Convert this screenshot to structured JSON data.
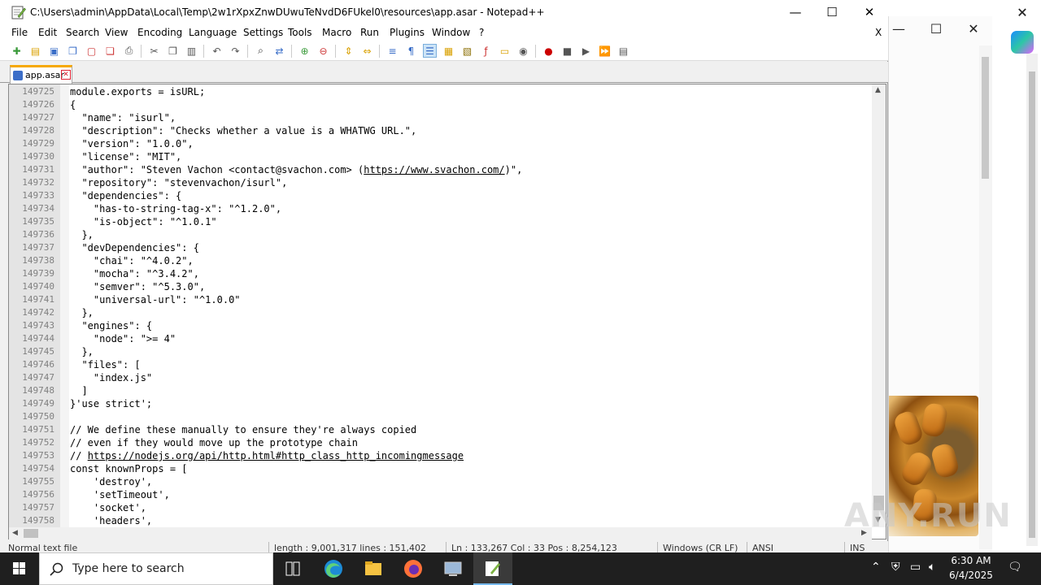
{
  "window": {
    "title": "C:\\Users\\admin\\AppData\\Local\\Temp\\2w1rXpxZnwDUwuTeNvdD6FUkel0\\resources\\app.asar - Notepad++",
    "minimize": "—",
    "maximize": "☐",
    "close": "✕"
  },
  "menu": {
    "items": [
      "File",
      "Edit",
      "Search",
      "View",
      "Encoding",
      "Language",
      "Settings",
      "Tools",
      "Macro",
      "Run",
      "Plugins",
      "Window",
      "?"
    ],
    "close_doc": "X"
  },
  "tab": {
    "label": "app.asar",
    "close": "✕"
  },
  "editor": {
    "line_numbers": [
      "149725",
      "149726",
      "149727",
      "149728",
      "149729",
      "149730",
      "149731",
      "149732",
      "149733",
      "149734",
      "149735",
      "149736",
      "149737",
      "149738",
      "149739",
      "149740",
      "149741",
      "149742",
      "149743",
      "149744",
      "149745",
      "149746",
      "149747",
      "149748",
      "149749",
      "149750",
      "149751",
      "149752",
      "149753",
      "149754",
      "149755",
      "149756",
      "149757",
      "149758"
    ],
    "lines": [
      "module.exports = isURL;",
      "{",
      "  \"name\": \"isurl\",",
      "  \"description\": \"Checks whether a value is a WHATWG URL.\",",
      "  \"version\": \"1.0.0\",",
      "  \"license\": \"MIT\",",
      "  \"author\": \"Steven Vachon <contact@svachon.com> (",
      "  \"repository\": \"stevenvachon/isurl\",",
      "  \"dependencies\": {",
      "    \"has-to-string-tag-x\": \"^1.2.0\",",
      "    \"is-object\": \"^1.0.1\"",
      "  },",
      "  \"devDependencies\": {",
      "    \"chai\": \"^4.0.2\",",
      "    \"mocha\": \"^3.4.2\",",
      "    \"semver\": \"^5.3.0\",",
      "    \"universal-url\": \"^1.0.0\"",
      "  },",
      "  \"engines\": {",
      "    \"node\": \">= 4\"",
      "  },",
      "  \"files\": [",
      "    \"index.js\"",
      "  ]",
      "}'use strict';",
      "",
      "// We define these manually to ensure they're always copied",
      "// even if they would move up the prototype chain",
      "// ",
      "const knownProps = [",
      "    'destroy',",
      "    'setTimeout',",
      "    'socket',",
      "    'headers',"
    ],
    "link_author": "https://www.svachon.com/",
    "link_author_tail": ")\",",
    "link_nodejs": "https://nodejs.org/api/http.html#http_class_http_incomingmessage"
  },
  "status": {
    "type": "Normal text file",
    "length": "length : 9,001,317    lines : 151,402",
    "position": "Ln : 133,267    Col : 33    Pos : 8,254,123",
    "eol": "Windows (CR LF)",
    "encoding": "ANSI",
    "mode": "INS"
  },
  "watermark": "ANY.RUN",
  "taskbar": {
    "search_placeholder": "Type here to search",
    "time": "6:30 AM",
    "date": "6/4/2025"
  }
}
